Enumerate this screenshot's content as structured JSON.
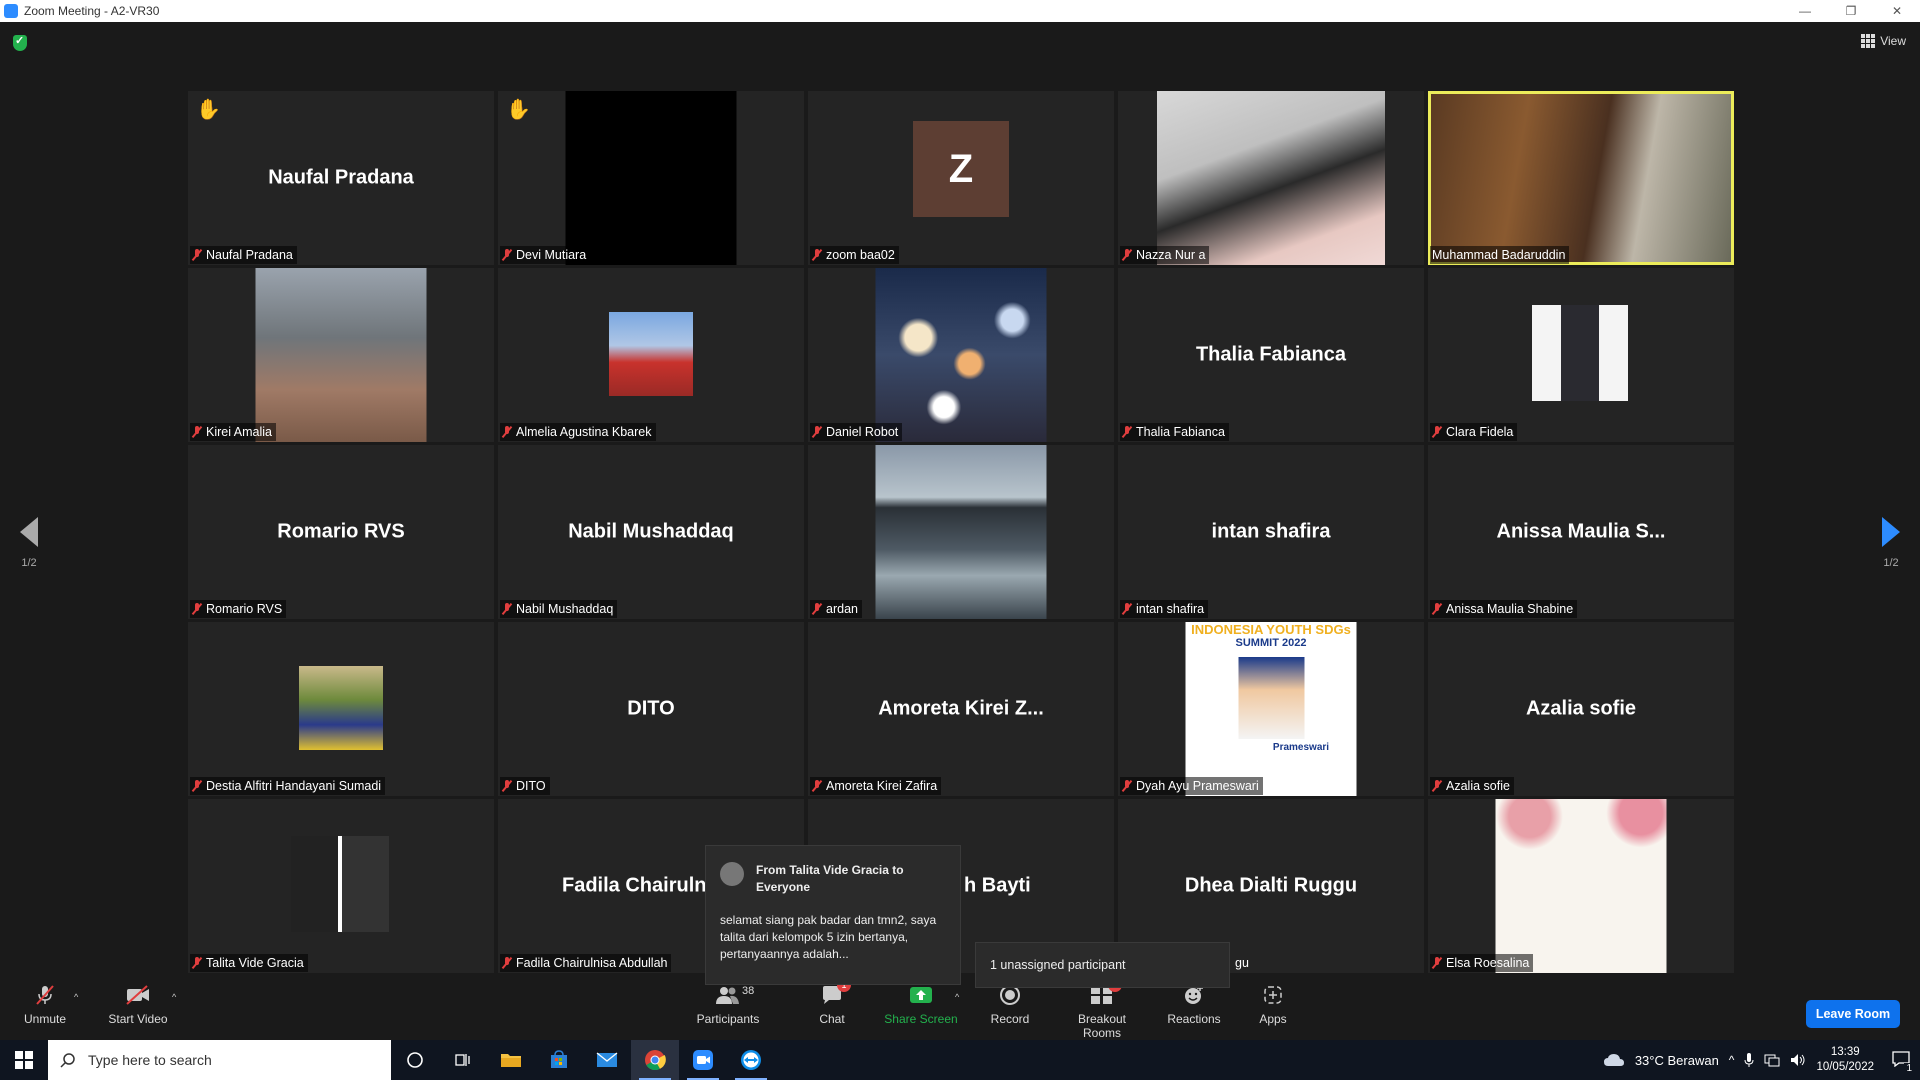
{
  "window": {
    "title": "Zoom Meeting - A2-VR30",
    "minimize": "—",
    "restore": "❐",
    "close": "✕"
  },
  "view_label": "View",
  "page_indicator": {
    "left": "1/2",
    "right": "1/2"
  },
  "tiles": [
    {
      "label": "Naufal Pradana",
      "big_name": "Naufal Pradana",
      "hand": true
    },
    {
      "label": "Devi Mutiara",
      "big_name": "",
      "hand": true
    },
    {
      "label": "zoom baa02",
      "big_name": "",
      "avatar_letter": "Z"
    },
    {
      "label": "Nazza Nur a",
      "big_name": ""
    },
    {
      "label": "Muhammad Badaruddin",
      "big_name": "",
      "active_speaker": true
    },
    {
      "label": "Kirei Amalia",
      "big_name": ""
    },
    {
      "label": "Almelia Agustina Kbarek",
      "big_name": ""
    },
    {
      "label": "Daniel Robot",
      "big_name": ""
    },
    {
      "label": "Thalia Fabianca",
      "big_name": "Thalia Fabianca"
    },
    {
      "label": "Clara Fidela",
      "big_name": ""
    },
    {
      "label": "Romario RVS",
      "big_name": "Romario RVS"
    },
    {
      "label": "Nabil Mushaddaq",
      "big_name": "Nabil Mushaddaq"
    },
    {
      "label": "ardan",
      "big_name": ""
    },
    {
      "label": "intan shafira",
      "big_name": "intan shafira"
    },
    {
      "label": "Anissa Maulia Shabine",
      "big_name": "Anissa  Maulia  S..."
    },
    {
      "label": "Destia Alfitri Handayani Sumadi",
      "big_name": ""
    },
    {
      "label": "DITO",
      "big_name": "DITO"
    },
    {
      "label": "Amoreta Kirei Zafira",
      "big_name": "Amoreta  Kirei  Z..."
    },
    {
      "label": "Dyah Ayu Prameswari",
      "big_name": "",
      "poster_title": "INDONESIA YOUTH SDGs",
      "poster_sub": "SUMMIT 2022",
      "poster_name": "Prameswari"
    },
    {
      "label": "Azalia sofie",
      "big_name": "Azalia sofie"
    },
    {
      "label": "Talita Vide Gracia",
      "big_name": ""
    },
    {
      "label": "Fadila Chairulnisa Abdullah",
      "big_name": "Fadila  Chairuln"
    },
    {
      "label": "",
      "big_name": "h Bayti"
    },
    {
      "label": "gu",
      "big_name": "Dhea Dialti Ruggu"
    },
    {
      "label": "Elsa Roesalina",
      "big_name": ""
    }
  ],
  "chat_popup": {
    "from": "From Talita Vide Gracia to Everyone",
    "message": "selamat siang pak badar dan tmn2, saya talita dari kelompok 5 izin bertanya, pertanyaannya adalah..."
  },
  "unassigned_notice": "1 unassigned participant",
  "toolbar": {
    "unmute": "Unmute",
    "start_video": "Start Video",
    "participants": "Participants",
    "participants_count": "38",
    "chat": "Chat",
    "chat_badge": "1",
    "share_screen": "Share Screen",
    "record": "Record",
    "breakout_rooms": "Breakout Rooms",
    "breakout_badge": "1",
    "reactions": "Reactions",
    "apps": "Apps",
    "leave_room": "Leave Room"
  },
  "taskbar": {
    "search_placeholder": "Type here to search",
    "weather": "33°C  Berawan",
    "time": "13:39",
    "date": "10/05/2022",
    "notification_count": "1"
  },
  "colors": {
    "active_speaker_border": "#ecec5a",
    "share_green": "#23b14d",
    "leave_blue": "#0e72ed",
    "mute_red": "#e03e3e"
  }
}
